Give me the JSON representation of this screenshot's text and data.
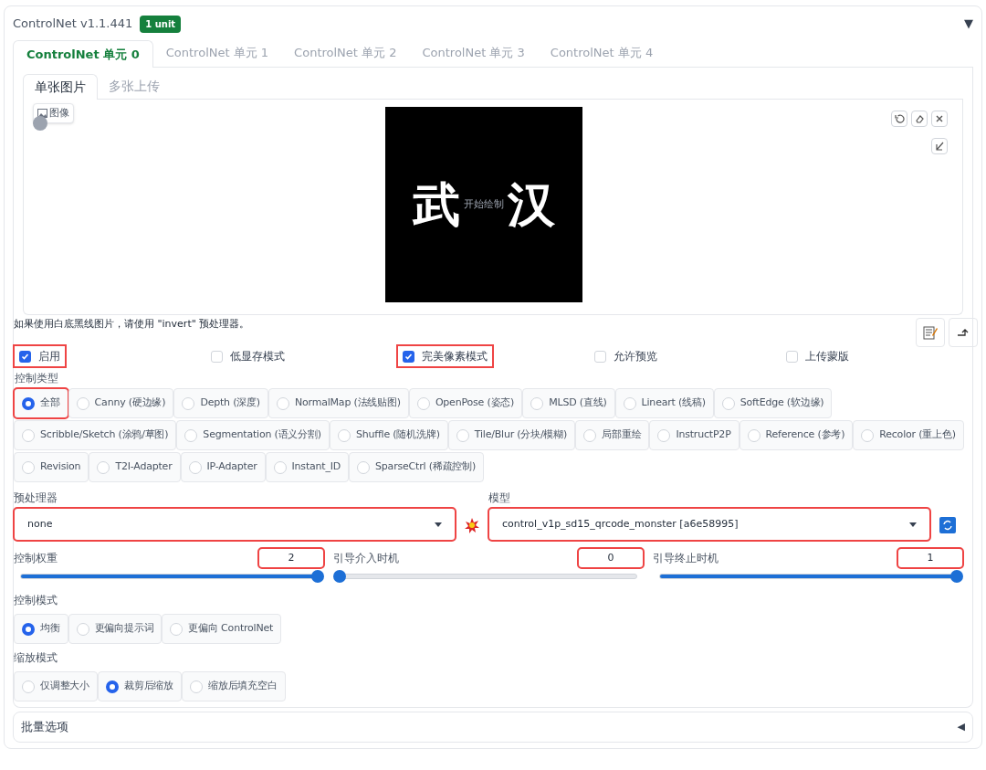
{
  "header": {
    "title": "ControlNet v1.1.441",
    "badge": "1 unit",
    "toggle": "▼"
  },
  "unit_tabs": [
    {
      "label": "ControlNet 单元 0",
      "selected": true
    },
    {
      "label": "ControlNet 单元 1",
      "selected": false
    },
    {
      "label": "ControlNet 单元 2",
      "selected": false
    },
    {
      "label": "ControlNet 单元 3",
      "selected": false
    },
    {
      "label": "ControlNet 单元 4",
      "selected": false
    }
  ],
  "image_tabs": [
    {
      "label": "单张图片",
      "selected": true
    },
    {
      "label": "多张上传",
      "selected": false
    }
  ],
  "canvas": {
    "image_label": "图像",
    "image_text": [
      "武",
      "汉"
    ],
    "overlay": "开始绘制"
  },
  "hint": "如果使用白底黑线图片，请使用 \"invert\" 预处理器。",
  "options": [
    {
      "label": "启用",
      "checked": true,
      "highlighted": true
    },
    {
      "label": "低显存模式",
      "checked": false,
      "highlighted": false
    },
    {
      "label": "完美像素模式",
      "checked": true,
      "highlighted": true
    },
    {
      "label": "允许预览",
      "checked": false,
      "highlighted": false
    },
    {
      "label": "上传蒙版",
      "checked": false,
      "highlighted": false
    }
  ],
  "control_type": {
    "label": "控制类型",
    "options": [
      {
        "label": "全部",
        "selected": true,
        "highlighted": true
      },
      {
        "label": "Canny (硬边缘)",
        "selected": false,
        "highlighted": false
      },
      {
        "label": "Depth (深度)",
        "selected": false,
        "highlighted": false
      },
      {
        "label": "NormalMap (法线贴图)",
        "selected": false,
        "highlighted": false
      },
      {
        "label": "OpenPose (姿态)",
        "selected": false,
        "highlighted": false
      },
      {
        "label": "MLSD (直线)",
        "selected": false,
        "highlighted": false
      },
      {
        "label": "Lineart (线稿)",
        "selected": false,
        "highlighted": false
      },
      {
        "label": "SoftEdge (软边缘)",
        "selected": false,
        "highlighted": false
      },
      {
        "label": "Scribble/Sketch (涂鸦/草图)",
        "selected": false,
        "highlighted": false
      },
      {
        "label": "Segmentation (语义分割)",
        "selected": false,
        "highlighted": false
      },
      {
        "label": "Shuffle (随机洗牌)",
        "selected": false,
        "highlighted": false
      },
      {
        "label": "Tile/Blur (分块/模糊)",
        "selected": false,
        "highlighted": false
      },
      {
        "label": "局部重绘",
        "selected": false,
        "highlighted": false
      },
      {
        "label": "InstructP2P",
        "selected": false,
        "highlighted": false
      },
      {
        "label": "Reference (参考)",
        "selected": false,
        "highlighted": false
      },
      {
        "label": "Recolor (重上色)",
        "selected": false,
        "highlighted": false
      },
      {
        "label": "Revision",
        "selected": false,
        "highlighted": false
      },
      {
        "label": "T2I-Adapter",
        "selected": false,
        "highlighted": false
      },
      {
        "label": "IP-Adapter",
        "selected": false,
        "highlighted": false
      },
      {
        "label": "Instant_ID",
        "selected": false,
        "highlighted": false
      },
      {
        "label": "SparseCtrl (稀疏控制)",
        "selected": false,
        "highlighted": false
      }
    ]
  },
  "preprocessor": {
    "label": "预处理器",
    "value": "none",
    "highlighted": true
  },
  "model": {
    "label": "模型",
    "value": "control_v1p_sd15_qrcode_monster [a6e58995]",
    "highlighted": true
  },
  "sliders": [
    {
      "label": "控制权重",
      "value": "2",
      "level": 1,
      "highlighted": true
    },
    {
      "label": "引导介入时机",
      "value": "0",
      "level": 0,
      "highlighted": true
    },
    {
      "label": "引导终止时机",
      "value": "1",
      "level": 1,
      "highlighted": true
    }
  ],
  "control_mode": {
    "label": "控制模式",
    "options": [
      {
        "label": "均衡",
        "selected": true
      },
      {
        "label": "更偏向提示词",
        "selected": false
      },
      {
        "label": "更偏向 ControlNet",
        "selected": false
      }
    ]
  },
  "resize_mode": {
    "label": "缩放模式",
    "options": [
      {
        "label": "仅调整大小",
        "selected": false
      },
      {
        "label": "裁剪后缩放",
        "selected": true
      },
      {
        "label": "缩放后填充空白",
        "selected": false
      }
    ]
  },
  "batch": {
    "label": "批量选项",
    "toggle": "◀"
  }
}
